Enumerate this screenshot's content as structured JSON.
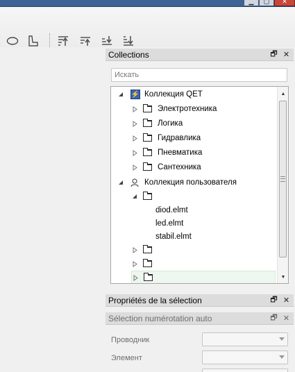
{
  "window": {
    "controls": {
      "minimize": "▁",
      "maximize": "▢",
      "close": "✕"
    }
  },
  "toolbar": {
    "icons": [
      "ellipse-tool-icon",
      "polygon-tool-icon",
      "bring-to-front-icon",
      "raise-icon",
      "lower-icon",
      "send-to-back-icon"
    ]
  },
  "collections_panel": {
    "title": "Collections",
    "float_glyph": "🗗",
    "close_glyph": "✕",
    "search": {
      "placeholder": "Искать",
      "value": ""
    },
    "tree": {
      "qet_collection": {
        "label": "Коллекция QET",
        "children": [
          "Электротехника",
          "Логика",
          "Гидравлика",
          "Пневматика",
          "Сантехника"
        ]
      },
      "user_collection": {
        "label": "Коллекция пользователя",
        "first_folder": {
          "label": "",
          "files": [
            "diod.elmt",
            "led.elmt",
            "stabil.elmt"
          ]
        },
        "other_folders": [
          "",
          "",
          ""
        ]
      }
    }
  },
  "selection_properties_panel": {
    "title": "Propriétés de la sélection",
    "float_glyph": "🗗",
    "close_glyph": "✕"
  },
  "autonum_panel": {
    "title": "Sélection numérotation auto",
    "float_glyph": "🗗",
    "close_glyph": "✕",
    "fields": [
      {
        "label": "Проводник",
        "value": ""
      },
      {
        "label": "Элемент",
        "value": ""
      }
    ]
  }
}
